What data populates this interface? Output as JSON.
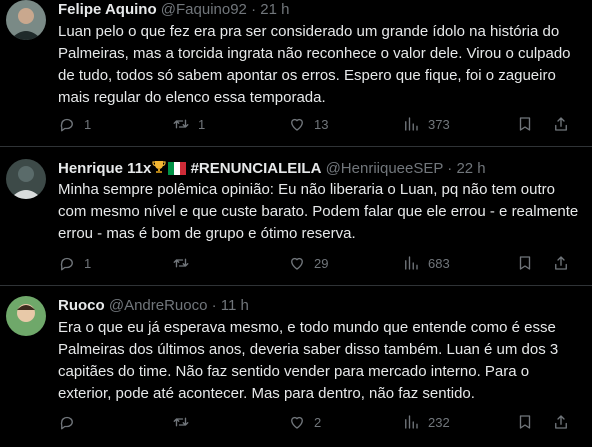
{
  "tweets": [
    {
      "name": "Felipe Aquino",
      "handle": "@Faquino92",
      "time": "· 21 h",
      "text": "Luan pelo o que fez era pra ser considerado um grande ídolo na história do Palmeiras, mas a torcida ingrata não reconhece o valor dele. Virou o culpado de tudo, todos só sabem apontar os erros. Espero que fique, foi o zagueiro mais regular do elenco essa temporada.",
      "replies": "1",
      "retweets": "1",
      "likes": "13",
      "views": "373"
    },
    {
      "name_prefix": "Henrique 11x",
      "name_suffix": "#RENUNCIALEILA",
      "handle": "@HenriiqueeSEP",
      "time": "· 22 h",
      "text": "Minha sempre polêmica opinião: Eu não liberaria o Luan, pq não tem outro com mesmo nível e que custe barato. Podem falar que ele errou - e realmente errou - mas é bom de grupo e ótimo reserva.",
      "replies": "1",
      "retweets": "",
      "likes": "29",
      "views": "683"
    },
    {
      "name": "Ruoco",
      "handle": "@AndreRuoco",
      "time": "· 11 h",
      "text": "Era o que eu já esperava mesmo, e todo mundo que entende como é esse Palmeiras dos últimos anos, deveria saber disso também. Luan é um dos 3 capitães do time. Não faz sentido vender para mercado interno. Para o exterior, pode até acontecer. Mas para dentro, não faz sentido.",
      "replies": "",
      "retweets": "",
      "likes": "2",
      "views": "232"
    }
  ],
  "icons": {
    "reply": "reply-icon",
    "retweet": "retweet-icon",
    "like": "heart-icon",
    "views": "views-icon",
    "bookmark": "bookmark-icon",
    "share": "share-icon"
  },
  "colors": {
    "background": "#000000",
    "text": "#e7e9ea",
    "muted": "#71767b",
    "divider": "#2f3336"
  }
}
